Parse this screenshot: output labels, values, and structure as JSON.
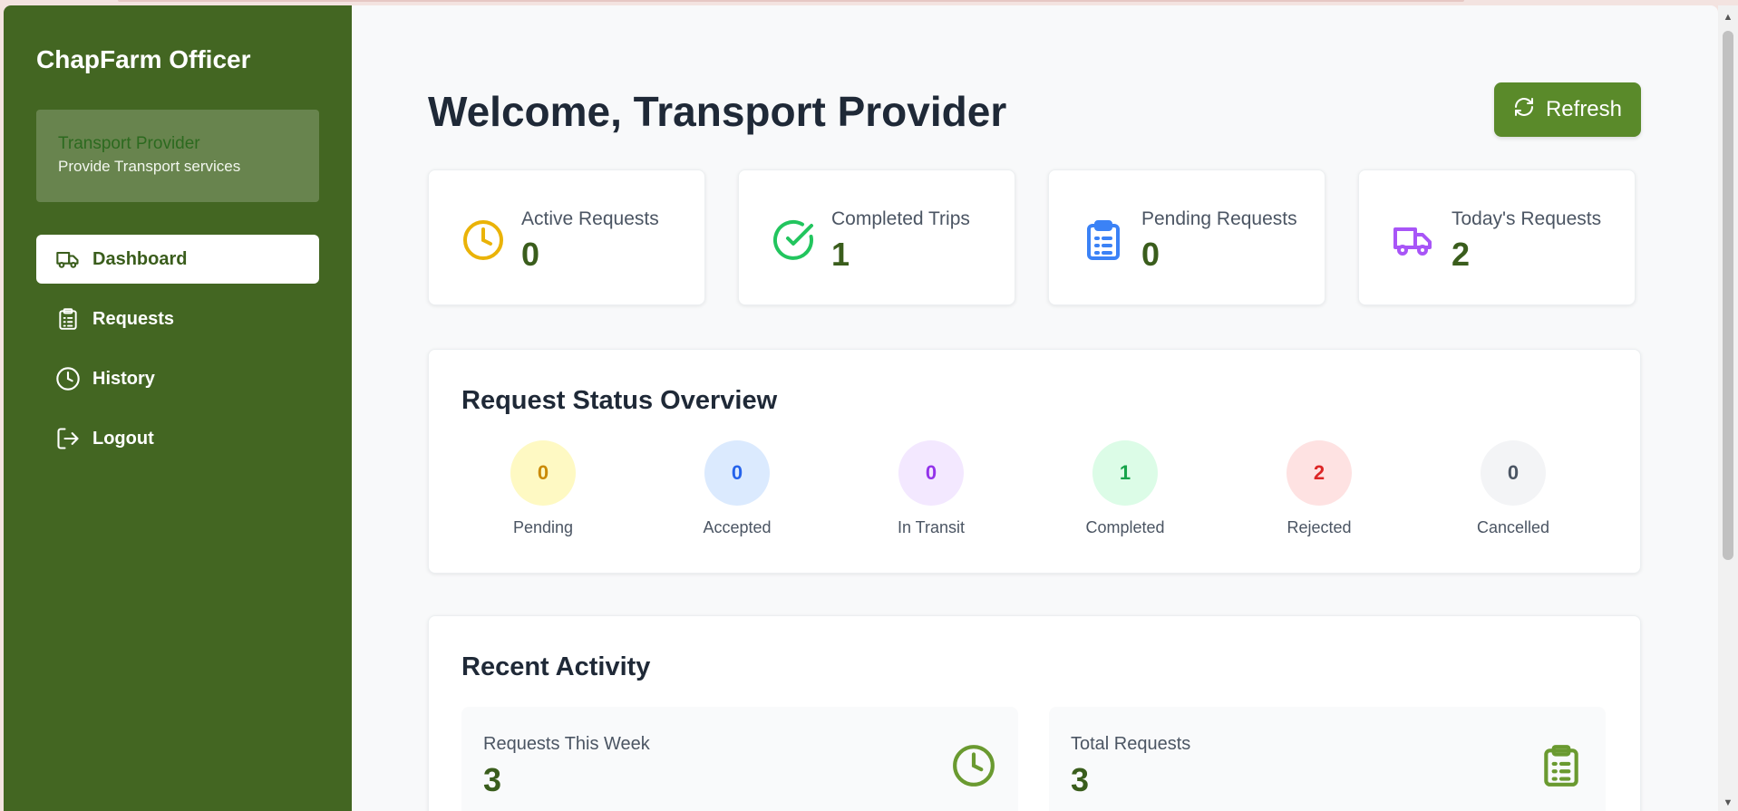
{
  "sidebar": {
    "brand": "ChapFarm Officer",
    "role_title": "Transport Provider",
    "role_subtitle": "Provide Transport services",
    "items": [
      {
        "label": "Dashboard",
        "icon": "truck-icon",
        "active": true
      },
      {
        "label": "Requests",
        "icon": "clipboard-icon",
        "active": false
      },
      {
        "label": "History",
        "icon": "clock-icon",
        "active": false
      },
      {
        "label": "Logout",
        "icon": "logout-icon",
        "active": false
      }
    ]
  },
  "header": {
    "title": "Welcome, Transport Provider",
    "refresh_label": "Refresh"
  },
  "stats": [
    {
      "label": "Active Requests",
      "value": "0",
      "icon": "clock-icon",
      "color": "#eab308"
    },
    {
      "label": "Completed Trips",
      "value": "1",
      "icon": "check-circle-icon",
      "color": "#22c55e"
    },
    {
      "label": "Pending Requests",
      "value": "0",
      "icon": "clipboard-icon",
      "color": "#3b82f6"
    },
    {
      "label": "Today's Requests",
      "value": "2",
      "icon": "truck-icon",
      "color": "#a855f7"
    }
  ],
  "status_overview": {
    "title": "Request Status Overview",
    "items": [
      {
        "label": "Pending",
        "value": "0",
        "bg": "#fef9c3",
        "fg": "#ca8a04"
      },
      {
        "label": "Accepted",
        "value": "0",
        "bg": "#dbeafe",
        "fg": "#2563eb"
      },
      {
        "label": "In Transit",
        "value": "0",
        "bg": "#f3e8ff",
        "fg": "#9333ea"
      },
      {
        "label": "Completed",
        "value": "1",
        "bg": "#dcfce7",
        "fg": "#16a34a"
      },
      {
        "label": "Rejected",
        "value": "2",
        "bg": "#fee2e2",
        "fg": "#dc2626"
      },
      {
        "label": "Cancelled",
        "value": "0",
        "bg": "#f3f4f6",
        "fg": "#4b5563"
      }
    ]
  },
  "recent_activity": {
    "title": "Recent Activity",
    "items": [
      {
        "label": "Requests This Week",
        "value": "3",
        "icon": "clock-icon"
      },
      {
        "label": "Total Requests",
        "value": "3",
        "icon": "clipboard-icon"
      }
    ]
  },
  "colors": {
    "sidebar_bg": "#436622",
    "accent": "#5a8a2a",
    "value_text": "#3a5d1c"
  }
}
